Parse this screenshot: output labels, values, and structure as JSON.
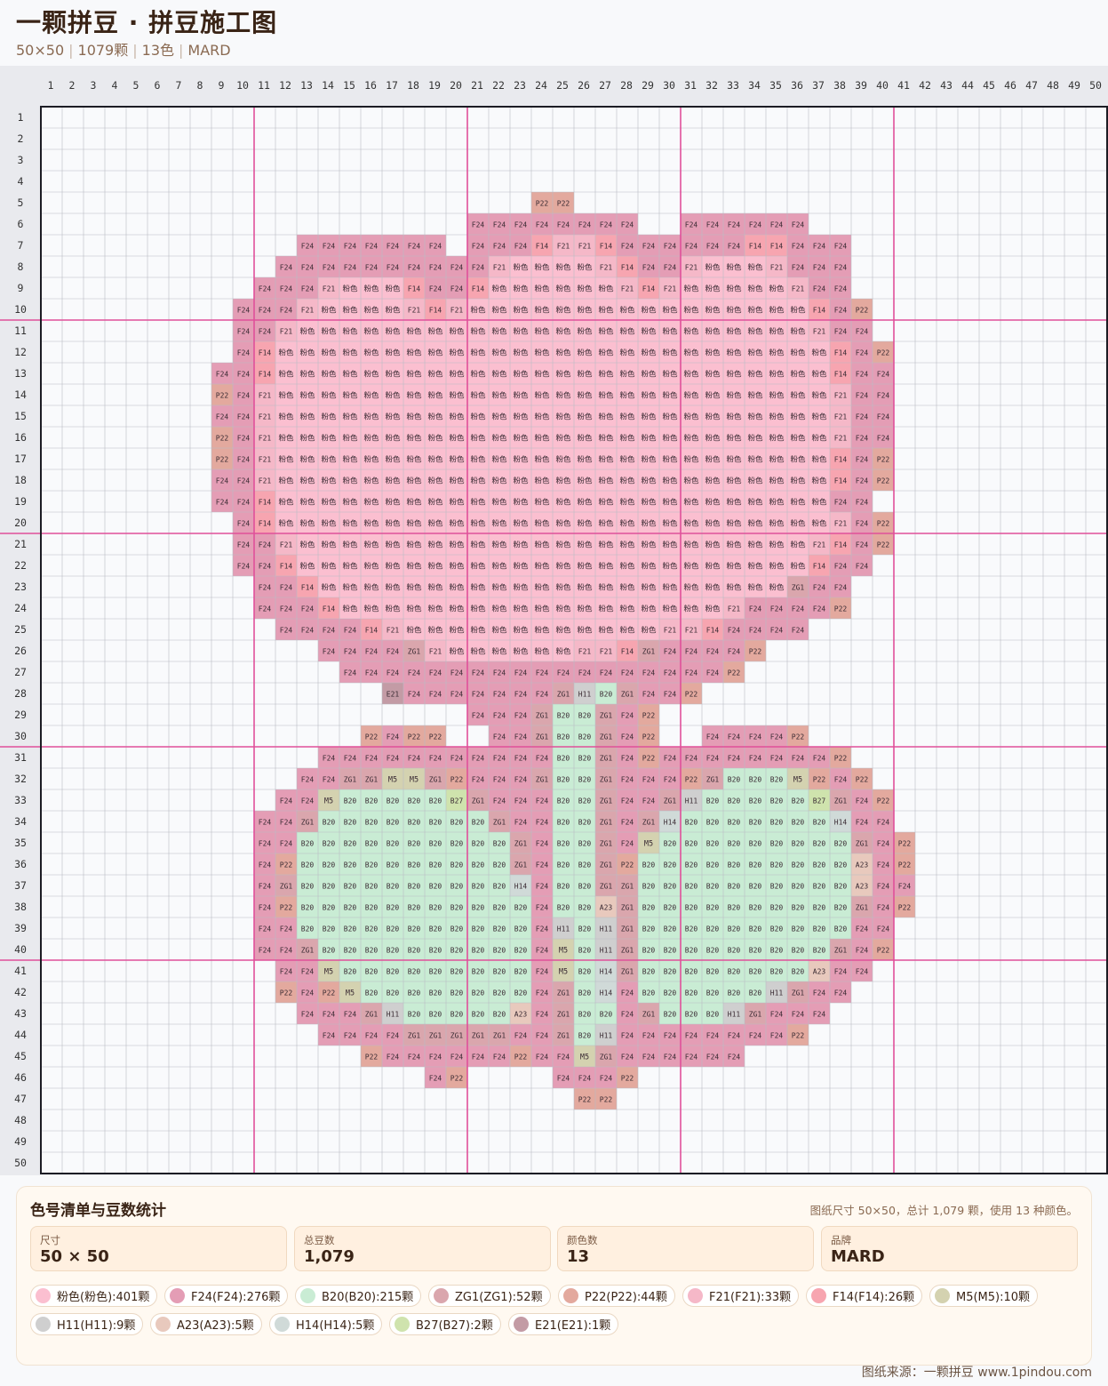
{
  "header": {
    "title": "一颗拼豆 · 拼豆施工图",
    "size": "50×50",
    "count": "1079颗",
    "colors": "13色",
    "brand": "MARD"
  },
  "grid": {
    "cols": 50,
    "rows": 50,
    "major_every": 10,
    "major_line_color": "#e0509a",
    "palette": {
      "粉色": "#fbbfd0",
      "F24": "#e49db5",
      "B20": "#c9ecd4",
      "ZG1": "#daa6ad",
      "P22": "#e3a99e",
      "F21": "#f5b8c8",
      "F14": "#f7a5b0",
      "M5": "#d4d2b0",
      "H11": "#cfcfcf",
      "A23": "#e8c9bd",
      "H14": "#d0dad8",
      "B27": "#cfe3ad",
      "E21": "#c39ba5"
    },
    "rows_data": [
      "",
      "",
      "",
      "",
      "24:P22,P22",
      "21:F24,F24,F24,F24,F24,F24,F24,F24,,,F24,F24,F24,F24,F24,F24",
      "13:F24,F24,F24,F24,F24,F24,F24,,F24,F24,F24,F14,F21,F21,F14,F24,F24,F24,F24,F24,F24,F14,F14,F24,F24,F24",
      "12:F24,F24,F24,F24,F24,F24,F24,F24,F24,F24,F21,粉色,粉色,粉色,粉色,F21,F14,F24,F24,F21,粉色,粉色,粉色,F21,F24,F24,F24",
      "11:F24,F24,F24,F21,粉色,粉色,粉色,F14,F24,F24,F14,粉色,粉色,粉色,粉色,粉色,粉色,F21,F14,F21,粉色,粉色,粉色,粉色,粉色,F21,F24,F24",
      "10:F24,F24,F24,F21,粉色,粉色,粉色,粉色,F21,F14,F21,粉色,粉色,粉色,粉色,粉色,粉色,粉色,粉色,粉色,粉色,粉色,粉色,粉色,粉色,粉色,粉色,F14,F24,P22",
      "10:F24,F24,F21,粉色,粉色,粉色,粉色,粉色,粉色,粉色,粉色,粉色,粉色,粉色,粉色,粉色,粉色,粉色,粉色,粉色,粉色,粉色,粉色,粉色,粉色,粉色,粉色,F21,F24,F24",
      "10:F24,F14,粉色,粉色,粉色,粉色,粉色,粉色,粉色,粉色,粉色,粉色,粉色,粉色,粉色,粉色,粉色,粉色,粉色,粉色,粉色,粉色,粉色,粉色,粉色,粉色,粉色,粉色,F14,F24,P22",
      "9:F24,F24,F14,粉色,粉色,粉色,粉色,粉色,粉色,粉色,粉色,粉色,粉色,粉色,粉色,粉色,粉色,粉色,粉色,粉色,粉色,粉色,粉色,粉色,粉色,粉色,粉色,粉色,粉色,F14,F24,F24",
      "9:P22,F24,F21,粉色,粉色,粉色,粉色,粉色,粉色,粉色,粉色,粉色,粉色,粉色,粉色,粉色,粉色,粉色,粉色,粉色,粉色,粉色,粉色,粉色,粉色,粉色,粉色,粉色,粉色,F21,F24,F24",
      "9:F24,F24,F21,粉色,粉色,粉色,粉色,粉色,粉色,粉色,粉色,粉色,粉色,粉色,粉色,粉色,粉色,粉色,粉色,粉色,粉色,粉色,粉色,粉色,粉色,粉色,粉色,粉色,粉色,F21,F24,F24",
      "9:P22,F24,F21,粉色,粉色,粉色,粉色,粉色,粉色,粉色,粉色,粉色,粉色,粉色,粉色,粉色,粉色,粉色,粉色,粉色,粉色,粉色,粉色,粉色,粉色,粉色,粉色,粉色,粉色,F21,F24,F24",
      "9:P22,F24,F21,粉色,粉色,粉色,粉色,粉色,粉色,粉色,粉色,粉色,粉色,粉色,粉色,粉色,粉色,粉色,粉色,粉色,粉色,粉色,粉色,粉色,粉色,粉色,粉色,粉色,粉色,F14,F24,P22",
      "9:F24,F24,F21,粉色,粉色,粉色,粉色,粉色,粉色,粉色,粉色,粉色,粉色,粉色,粉色,粉色,粉色,粉色,粉色,粉色,粉色,粉色,粉色,粉色,粉色,粉色,粉色,粉色,粉色,F14,F24,P22",
      "9:F24,F24,F14,粉色,粉色,粉色,粉色,粉色,粉色,粉色,粉色,粉色,粉色,粉色,粉色,粉色,粉色,粉色,粉色,粉色,粉色,粉色,粉色,粉色,粉色,粉色,粉色,粉色,粉色,F24,F24",
      "10:F24,F14,粉色,粉色,粉色,粉色,粉色,粉色,粉色,粉色,粉色,粉色,粉色,粉色,粉色,粉色,粉色,粉色,粉色,粉色,粉色,粉色,粉色,粉色,粉色,粉色,粉色,粉色,F21,F24,P22",
      "10:F24,F24,F21,粉色,粉色,粉色,粉色,粉色,粉色,粉色,粉色,粉色,粉色,粉色,粉色,粉色,粉色,粉色,粉色,粉色,粉色,粉色,粉色,粉色,粉色,粉色,粉色,F21,F14,F24,P22",
      "10:F24,F24,F14,粉色,粉色,粉色,粉色,粉色,粉色,粉色,粉色,粉色,粉色,粉色,粉色,粉色,粉色,粉色,粉色,粉色,粉色,粉色,粉色,粉色,粉色,粉色,粉色,F14,F24,F24",
      "11:F24,F24,F14,粉色,粉色,粉色,粉色,粉色,粉色,粉色,粉色,粉色,粉色,粉色,粉色,粉色,粉色,粉色,粉色,粉色,粉色,粉色,粉色,粉色,粉色,ZG1,F24,F24",
      "11:F24,F24,F24,F14,粉色,粉色,粉色,粉色,粉色,粉色,粉色,粉色,粉色,粉色,粉色,粉色,粉色,粉色,粉色,粉色,粉色,粉色,F21,F24,F24,F24,F24,P22",
      "12:F24,F24,F24,F24,F14,F21,粉色,粉色,粉色,粉色,粉色,粉色,粉色,粉色,粉色,粉色,粉色,粉色,F21,F21,F14,F24,F24,F24,F24",
      "14:F24,F24,F24,F24,ZG1,F21,粉色,粉色,粉色,粉色,粉色,粉色,F21,F21,F14,ZG1,F24,F24,F24,F24,P22",
      "15:F24,F24,F24,F24,F24,F24,F24,F24,F24,F24,F24,F24,F24,F24,F24,F24,F24,F24,P22",
      "17:E21,F24,F24,F24,F24,F24,F24,F24,ZG1,H11,B20,ZG1,F24,F24,P22",
      "21:F24,F24,F24,ZG1,B20,B20,ZG1,F24,P22",
      "16:P22,F24,P22,P22,,,F24,F24,ZG1,B20,B20,ZG1,F24,P22,,,F24,F24,F24,F24,P22",
      "14:F24,F24,F24,F24,F24,F24,F24,F24,F24,F24,F24,B20,B20,ZG1,F24,P22,F24,F24,F24,F24,F24,F24,F24,F24,P22",
      "13:F24,F24,ZG1,ZG1,M5,M5,ZG1,P22,F24,F24,F24,ZG1,B20,B20,ZG1,F24,F24,F24,P22,ZG1,B20,B20,B20,M5,P22,F24,P22",
      "12:F24,F24,M5,B20,B20,B20,B20,B20,B27,ZG1,F24,F24,F24,B20,B20,ZG1,F24,F24,ZG1,H11,B20,B20,B20,B20,B20,B27,ZG1,F24,P22",
      "11:F24,F24,ZG1,B20,B20,B20,B20,B20,B20,B20,B20,ZG1,F24,F24,B20,B20,ZG1,F24,ZG1,H14,B20,B20,B20,B20,B20,B20,B20,H14,F24,F24",
      "11:F24,F24,B20,B20,B20,B20,B20,B20,B20,B20,B20,B20,ZG1,F24,B20,B20,ZG1,F24,M5,B20,B20,B20,B20,B20,B20,B20,B20,B20,ZG1,F24,P22",
      "11:F24,P22,B20,B20,B20,B20,B20,B20,B20,B20,B20,B20,ZG1,F24,B20,B20,ZG1,P22,B20,B20,B20,B20,B20,B20,B20,B20,B20,B20,A23,F24,P22",
      "11:F24,ZG1,B20,B20,B20,B20,B20,B20,B20,B20,B20,B20,H14,F24,B20,B20,ZG1,ZG1,B20,B20,B20,B20,B20,B20,B20,B20,B20,B20,A23,F24,F24",
      "11:F24,P22,B20,B20,B20,B20,B20,B20,B20,B20,B20,B20,B20,F24,B20,B20,A23,ZG1,B20,B20,B20,B20,B20,B20,B20,B20,B20,B20,ZG1,F24,P22",
      "11:F24,F24,B20,B20,B20,B20,B20,B20,B20,B20,B20,B20,B20,F24,H11,B20,H11,ZG1,B20,B20,B20,B20,B20,B20,B20,B20,B20,B20,F24,F24",
      "11:F24,F24,ZG1,B20,B20,B20,B20,B20,B20,B20,B20,B20,B20,F24,M5,B20,H11,ZG1,B20,B20,B20,B20,B20,B20,B20,B20,B20,ZG1,F24,P22",
      "12:F24,F24,M5,B20,B20,B20,B20,B20,B20,B20,B20,B20,F24,M5,B20,H14,ZG1,B20,B20,B20,B20,B20,B20,B20,B20,A23,F24,F24",
      "12:P22,F24,P22,M5,B20,B20,B20,B20,B20,B20,B20,B20,F24,ZG1,B20,H14,F24,B20,B20,B20,B20,B20,B20,H11,ZG1,F24,F24",
      "13:F24,F24,F24,ZG1,H11,B20,B20,B20,B20,B20,A23,F24,ZG1,B20,B20,F24,ZG1,B20,B20,B20,H11,ZG1,F24,F24,F24",
      "14:F24,F24,F24,F24,ZG1,ZG1,ZG1,ZG1,ZG1,F24,F24,ZG1,B20,H11,F24,F24,F24,F24,F24,F24,F24,F24,P22",
      "16:P22,F24,F24,F24,F24,F24,F24,P22,F24,F24,M5,ZG1,F24,F24,F24,F24,F24,F24",
      "19:F24,P22,,,,,F24,F24,F24,P22",
      "26:P22,P22",
      "",
      "",
      ""
    ]
  },
  "panel": {
    "title": "色号清单与豆数统计",
    "note": "图纸尺寸 50×50，总计 1,079 颗，使用 13 种颜色。",
    "stats": [
      {
        "label": "尺寸",
        "value": "50 × 50"
      },
      {
        "label": "总豆数",
        "value": "1,079"
      },
      {
        "label": "颜色数",
        "value": "13"
      },
      {
        "label": "品牌",
        "value": "MARD"
      }
    ],
    "legend": [
      {
        "text": "粉色(粉色):401颗",
        "color": "#fbbfd0"
      },
      {
        "text": "F24(F24):276颗",
        "color": "#e49db5"
      },
      {
        "text": "B20(B20):215颗",
        "color": "#c9ecd4"
      },
      {
        "text": "ZG1(ZG1):52颗",
        "color": "#daa6ad"
      },
      {
        "text": "P22(P22):44颗",
        "color": "#e3a99e"
      },
      {
        "text": "F21(F21):33颗",
        "color": "#f5b8c8"
      },
      {
        "text": "F14(F14):26颗",
        "color": "#f7a5b0"
      },
      {
        "text": "M5(M5):10颗",
        "color": "#d4d2b0"
      },
      {
        "text": "H11(H11):9颗",
        "color": "#cfcfcf"
      },
      {
        "text": "A23(A23):5颗",
        "color": "#e8c9bd"
      },
      {
        "text": "H14(H14):5颗",
        "color": "#d0dad8"
      },
      {
        "text": "B27(B27):2颗",
        "color": "#cfe3ad"
      },
      {
        "text": "E21(E21):1颗",
        "color": "#c39ba5"
      }
    ]
  },
  "footer": {
    "text": "图纸来源：一颗拼豆 www.1pindou.com"
  }
}
